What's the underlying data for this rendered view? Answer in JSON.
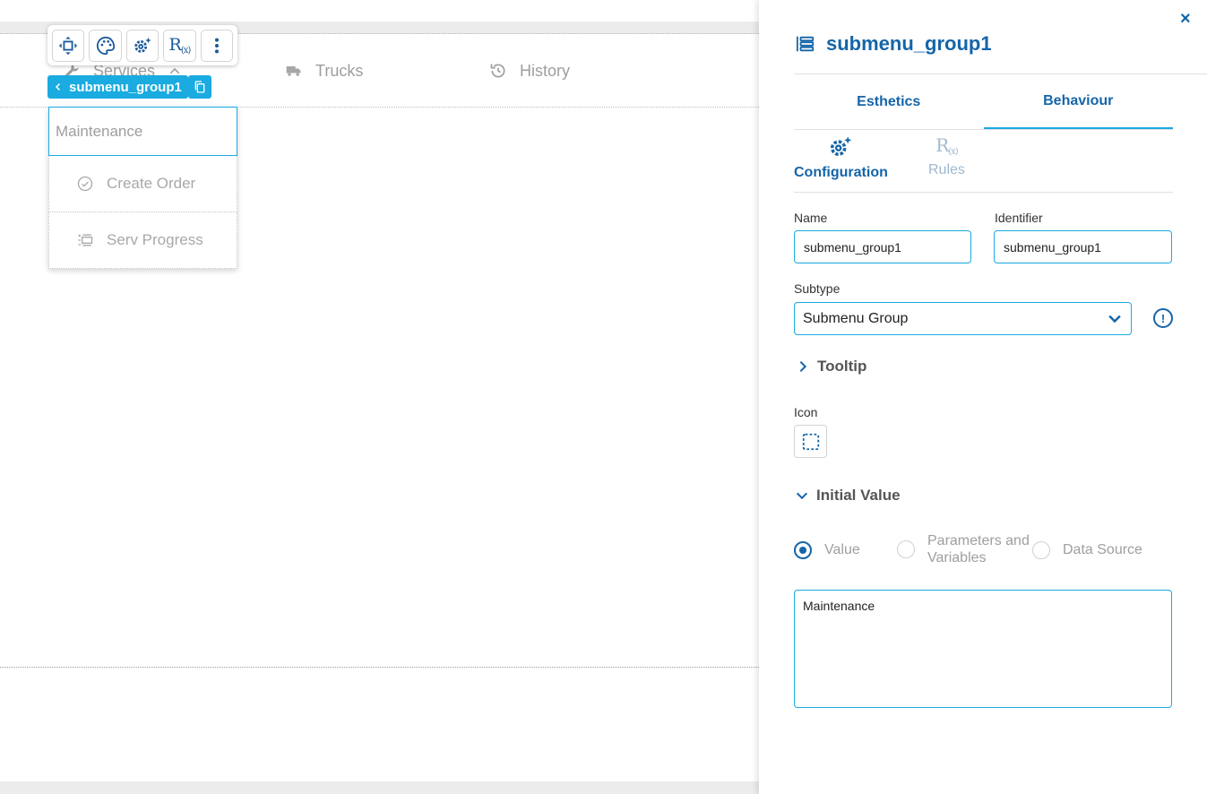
{
  "canvas": {
    "nav": [
      {
        "label": "Services",
        "icon": "wrench-icon"
      },
      {
        "label": "Trucks",
        "icon": "truck-icon"
      },
      {
        "label": "History",
        "icon": "history-icon"
      }
    ],
    "toolbar": {
      "rules_label": "R",
      "rules_sub": "(x)"
    },
    "tag_label": "submenu_group1",
    "submenu": {
      "header": "Maintenance",
      "items": [
        {
          "label": "Create Order",
          "icon": "check-circle-icon"
        },
        {
          "label": "Serv Progress",
          "icon": "progress-list-icon"
        }
      ]
    }
  },
  "panel": {
    "close_label": "×",
    "title": "submenu_group1",
    "tabs": [
      {
        "label": "Esthetics",
        "active": false
      },
      {
        "label": "Behaviour",
        "active": true
      }
    ],
    "subtabs": [
      {
        "label": "Configuration",
        "active": true
      },
      {
        "label": "Rules",
        "active": false
      }
    ],
    "name": {
      "label": "Name",
      "value": "submenu_group1"
    },
    "identifier": {
      "label": "Identifier",
      "value": "submenu_group1"
    },
    "subtype": {
      "label": "Subtype",
      "value": "Submenu Group"
    },
    "tooltip_label": "Tooltip",
    "icon_label": "Icon",
    "initial_value": {
      "label": "Initial Value",
      "options": [
        "Value",
        "Parameters and",
        "Variables",
        "Data Source"
      ],
      "selected": "Value",
      "value": "Maintenance"
    }
  },
  "colors": {
    "accent": "#1aabe0",
    "primary": "#1565a8",
    "muted": "#9e9e9e"
  }
}
